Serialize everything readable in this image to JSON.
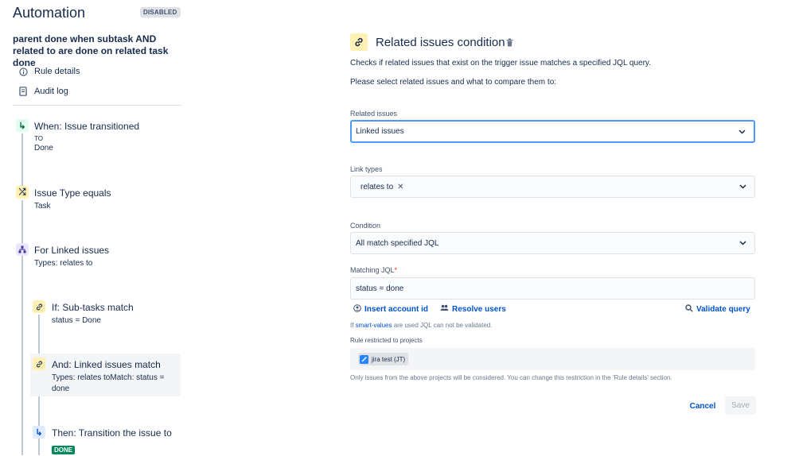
{
  "header": {
    "title": "Automation",
    "status_badge": "DISABLED"
  },
  "rule": {
    "name": "parent done when subtask AND related to are done on related task done",
    "links": [
      {
        "label": "Rule details",
        "icon": "info-icon"
      },
      {
        "label": "Audit log",
        "icon": "document-icon"
      }
    ]
  },
  "steps": [
    {
      "title": "When: Issue transitioned",
      "sub1": "TO",
      "sub2": "Done",
      "icon": "transition-icon"
    },
    {
      "title": "Issue Type equals",
      "sub1": "Task",
      "icon": "shuffle-icon"
    },
    {
      "title": "For Linked issues",
      "sub1": "Types: relates to",
      "icon": "hierarchy-icon"
    },
    {
      "title": "If: Sub-tasks match",
      "sub1": "status = Done",
      "icon": "link-icon"
    },
    {
      "title": "And: Linked issues match",
      "sub1": "Types: relates toMatch: status =",
      "sub2": "done",
      "icon": "link-icon"
    },
    {
      "title": "Then: Transition the issue to",
      "lozenge": "DONE",
      "icon": "transition-icon"
    }
  ],
  "panel": {
    "title": "Related issues condition",
    "description": "Checks if related issues that exist on the trigger issue matches a specified JQL query.",
    "instruction": "Please select related issues and what to compare them to:",
    "related_issues": {
      "label": "Related issues",
      "value": "Linked issues"
    },
    "link_types": {
      "label": "Link types",
      "chip": "relates to",
      "remove": "✕"
    },
    "condition": {
      "label": "Condition",
      "value": "All match specified JQL"
    },
    "jql": {
      "label": "Matching JQL",
      "required": "*",
      "value": "status = done"
    },
    "actions": {
      "insert_account": "Insert account id",
      "resolve_users": "Resolve users",
      "validate": "Validate query"
    },
    "smart_note": {
      "prefix": "If ",
      "link": "smart-values",
      "suffix": " are used JQL can not be validated."
    },
    "restricted": {
      "label": "Rule restricted to projects",
      "project": "jira test (JT)"
    },
    "scope_note": "Only issues from the above projects will be considered. You can change this restriction in the 'Rule details' section.",
    "buttons": {
      "cancel": "Cancel",
      "save": "Save"
    }
  }
}
